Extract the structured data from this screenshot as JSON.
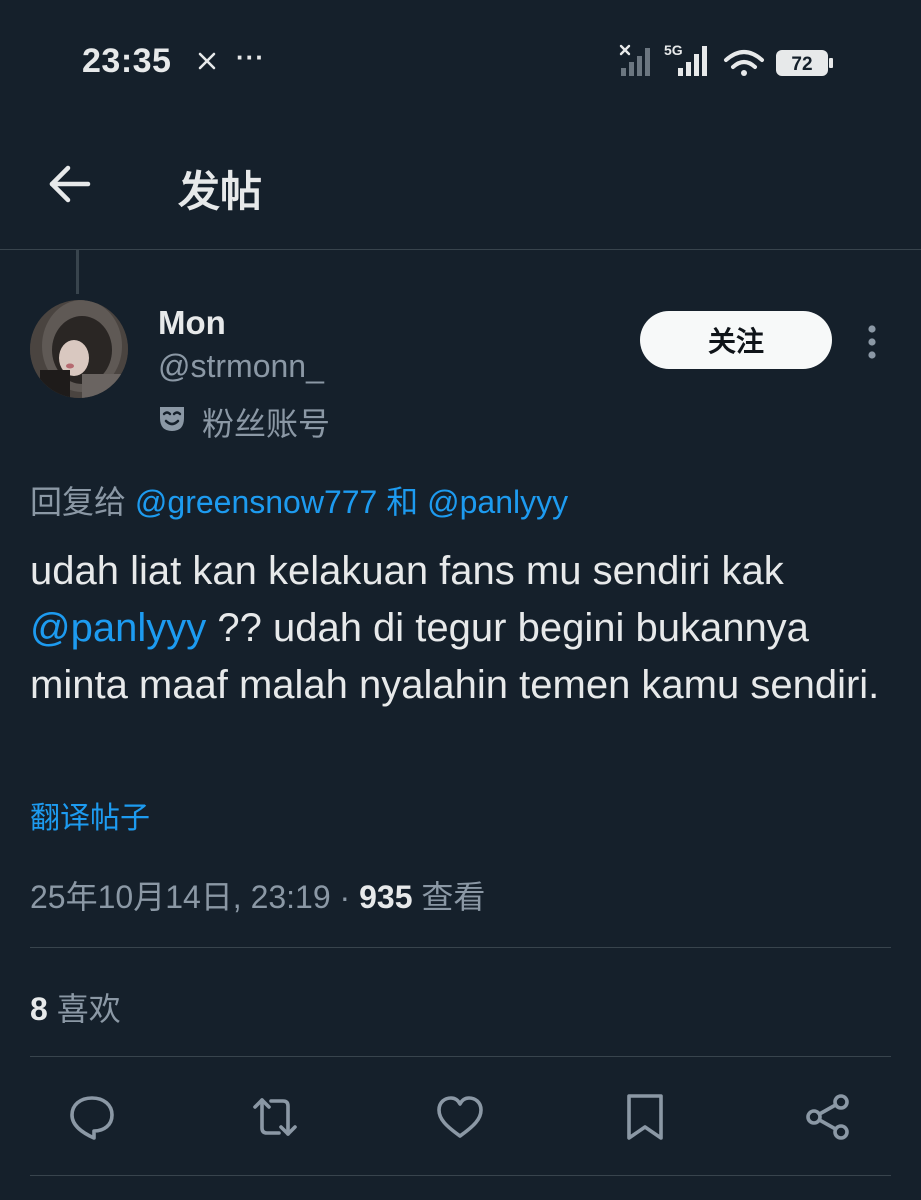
{
  "status_bar": {
    "time": "23:35",
    "x_icon": "x-logo-icon",
    "more_indicator": "···",
    "network": "5G",
    "battery": "72"
  },
  "header": {
    "title": "发帖",
    "back_icon": "arrow-left-icon"
  },
  "post": {
    "author": {
      "display_name": "Mon",
      "username": "@strmonn_",
      "badge_label": "粉丝账号",
      "badge_icon": "theater-mask-icon"
    },
    "follow_label": "关注",
    "reply_prefix": "回复给",
    "reply_mention_1": "@greensnow777",
    "reply_joiner": "和",
    "reply_mention_2": "@panlyyy",
    "text_part_1": "udah liat kan kelakuan fans mu sendiri kak ",
    "text_mention": "@panlyyy",
    "text_part_2": " ?? udah di tegur begini bukannya minta maaf malah nyalahin temen kamu sendiri.",
    "translate_label": "翻译帖子",
    "timestamp": "25年10月14日, 23:19",
    "separator": "·",
    "views_count": "935",
    "views_label": "查看",
    "likes_count": "8",
    "likes_label": "喜欢"
  },
  "actions": [
    {
      "name": "reply",
      "icon": "comment-icon"
    },
    {
      "name": "repost",
      "icon": "repost-icon"
    },
    {
      "name": "like",
      "icon": "heart-icon"
    },
    {
      "name": "bookmark",
      "icon": "bookmark-icon"
    },
    {
      "name": "share",
      "icon": "share-icon"
    }
  ],
  "colors": {
    "background": "#15202b",
    "accent": "#1d9bf0",
    "secondary_text": "#8b98a5",
    "divider": "#38444d"
  }
}
